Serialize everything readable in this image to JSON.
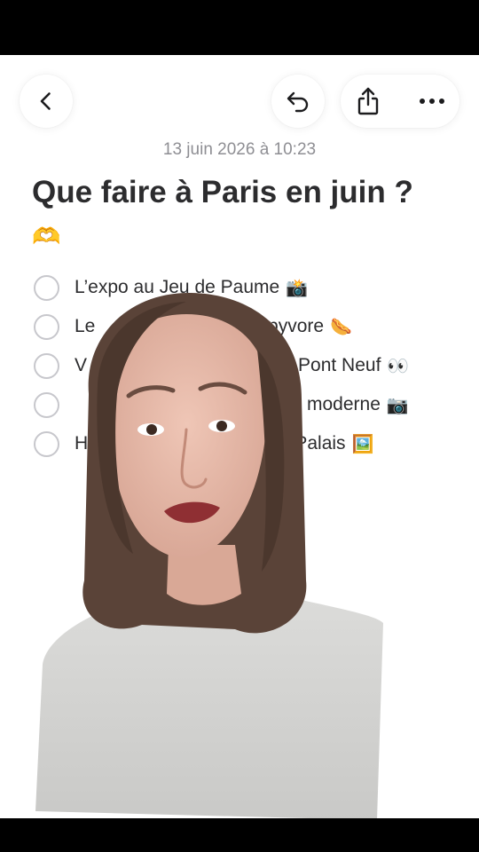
{
  "note": {
    "date": "13 juin 2026 à 10:23",
    "title": "Que faire à Paris en juin ?",
    "title_emoji": "🫶"
  },
  "checklist": [
    {
      "text": "L’expo au Jeu de Paume",
      "emoji": "📸",
      "checked": false
    },
    {
      "text": "Le",
      "right_text": "ppyvore",
      "emoji": "🌭",
      "checked": false
    },
    {
      "text": "V",
      "right_text": "r le Pont Neuf",
      "emoji": "👀",
      "checked": false
    },
    {
      "text": "",
      "right_text": "’art moderne",
      "emoji": "📷",
      "checked": false
    },
    {
      "text": "H",
      "right_text": "nd Palais",
      "emoji": "🖼️",
      "checked": false
    }
  ],
  "toolbar": {
    "back_icon": "chevron-left-icon",
    "undo_icon": "undo-icon",
    "share_icon": "share-icon",
    "more_icon": "more-icon"
  },
  "colors": {
    "background": "#ffffff",
    "text": "#2c2c2e",
    "secondary_text": "#8e8e93",
    "checkbox_border": "#c7c7cc"
  }
}
